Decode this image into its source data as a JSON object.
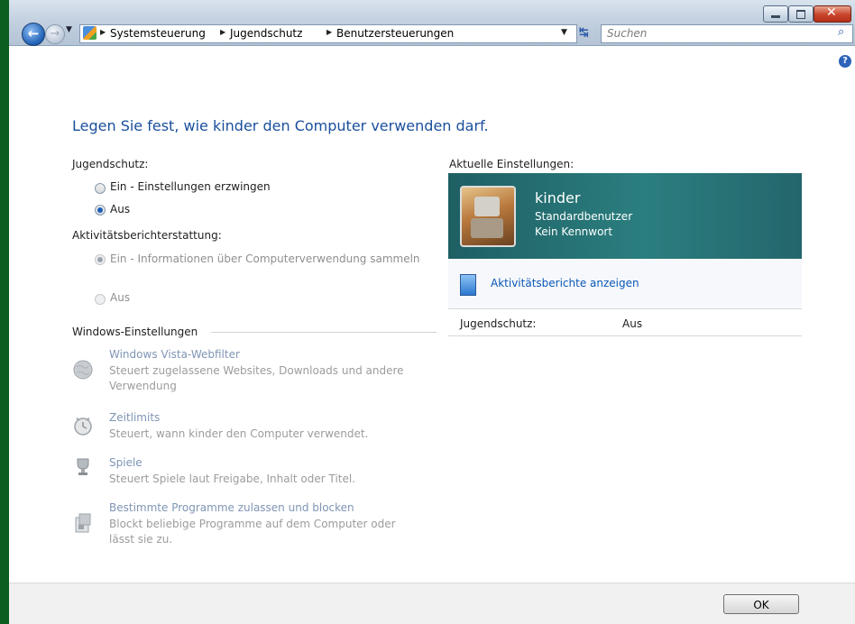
{
  "navigation": {
    "breadcrumb": [
      "Systemsteuerung",
      "Jugendschutz",
      "Benutzersteuerungen"
    ],
    "search_placeholder": "Suchen"
  },
  "main": {
    "title": "Legen Sie fest, wie kinder den Computer verwenden darf.",
    "parental_controls": {
      "label": "Jugendschutz:",
      "options": [
        {
          "label": "Ein - Einstellungen erzwingen",
          "selected": false
        },
        {
          "label": "Aus",
          "selected": true
        }
      ]
    },
    "activity_reporting": {
      "label": "Aktivitätsberichterstattung:",
      "options": [
        {
          "label": "Ein - Informationen über Computerverwendung sammeln",
          "selected": true,
          "enabled": false
        },
        {
          "label": "Aus",
          "selected": false,
          "enabled": false
        }
      ]
    },
    "windows_settings": {
      "heading": "Windows-Einstellungen",
      "items": [
        {
          "title": "Windows Vista-Webfilter",
          "description": "Steuert zugelassene Websites, Downloads und andere Verwendung",
          "icon": "globe-icon"
        },
        {
          "title": "Zeitlimits",
          "description": "Steuert, wann kinder den Computer verwendet.",
          "icon": "clock-icon"
        },
        {
          "title": "Spiele",
          "description": "Steuert Spiele laut Freigabe, Inhalt oder Titel.",
          "icon": "trophy-icon"
        },
        {
          "title": "Bestimmte Programme zulassen und blocken",
          "description": "Blockt beliebige Programme auf dem Computer oder lässt sie zu.",
          "icon": "programs-icon"
        }
      ]
    }
  },
  "current_settings": {
    "label": "Aktuelle Einstellungen:",
    "user": {
      "name": "kinder",
      "account_type": "Standardbenutzer",
      "password_status": "Kein Kennwort",
      "avatar": "robot-avatar"
    },
    "activity_report_link": "Aktivitätsberichte anzeigen",
    "summary": {
      "key": "Jugendschutz:",
      "value": "Aus"
    }
  },
  "footer": {
    "ok_label": "OK"
  },
  "colors": {
    "title_blue": "#1a4f9c",
    "link_blue": "#0b58b6",
    "user_panel_teal": "#2b7e7f"
  }
}
